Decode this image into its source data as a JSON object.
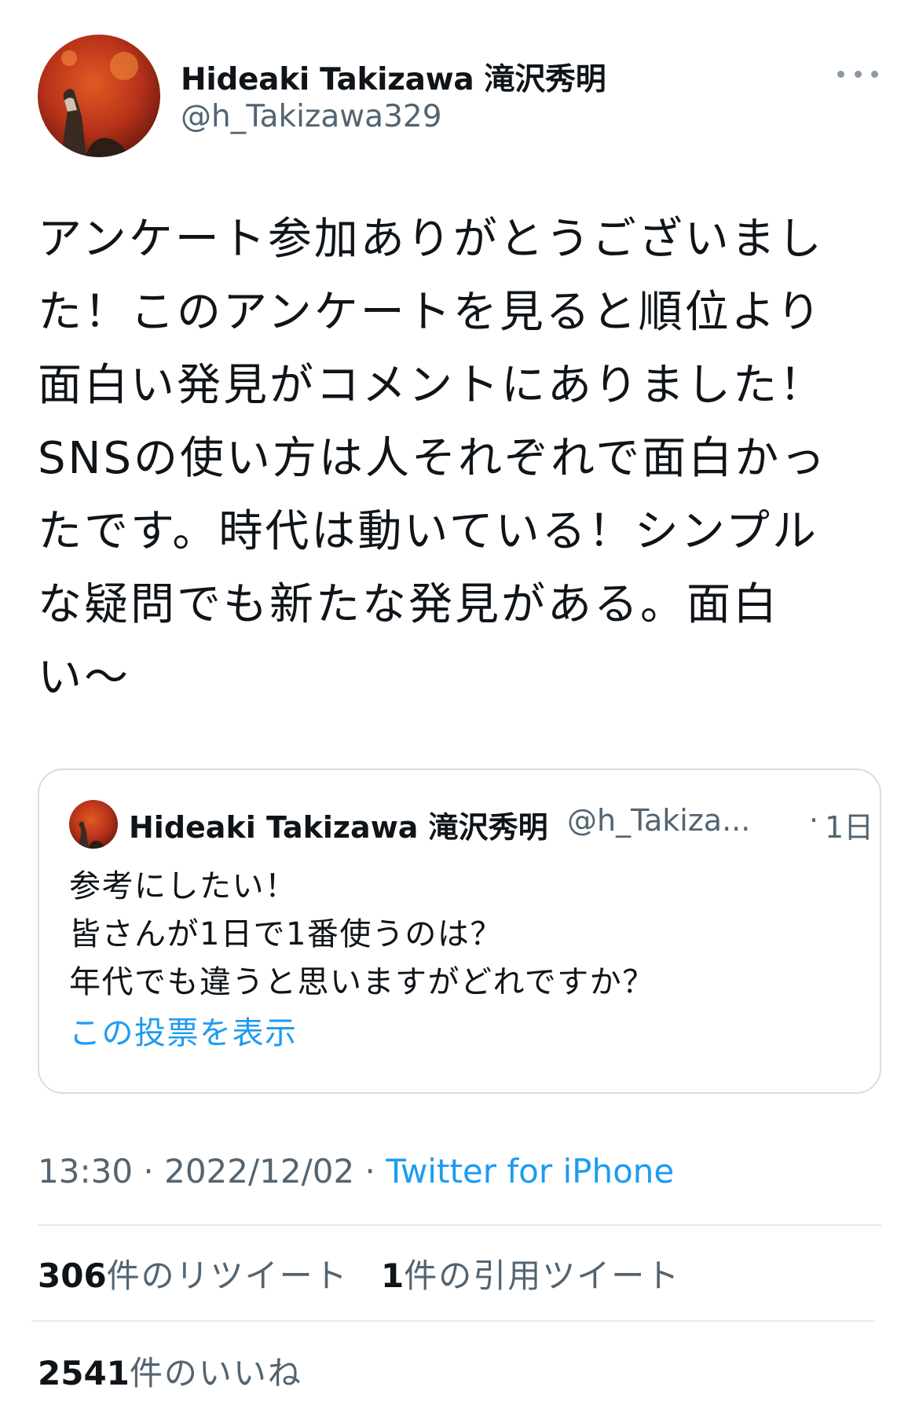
{
  "tweet": {
    "author": {
      "name": "Hideaki Takizawa 滝沢秀明",
      "handle": "@h_Takizawa329"
    },
    "text": "アンケート参加ありがとうございまし\nた！このアンケートを見ると順位より\n面白い発見がコメントにありました！\nSNSの使い方は人それぞれで面白かっ\nたです。時代は動いている！シンプル\nな疑問でも新たな発見がある。面白\nい〜",
    "quote": {
      "author_name": "Hideaki Takizawa 滝沢秀明",
      "author_handle": "@h_Takiza...",
      "separator": "·",
      "time": "1日",
      "text": "参考にしたい！\n皆さんが1日で1番使うのは？\n年代でも違うと思いますがどれですか？",
      "link_label": "この投票を表示"
    },
    "meta": {
      "time": "13:30",
      "sep1": " · ",
      "date": "2022/12/02",
      "sep2": " · ",
      "source": "Twitter for iPhone"
    },
    "stats": {
      "retweets": "306",
      "retweets_label": "件のリツイート",
      "quotes": "1",
      "quotes_label": "件の引用ツイート",
      "likes": "2541",
      "likes_label": "件のいいね"
    }
  },
  "colors": {
    "link": "#1d9bf0",
    "secondary_text": "#536471",
    "primary_text": "#0f1419",
    "border": "#d9dde1"
  },
  "icons": {
    "more": "more-horizontal-icon"
  }
}
